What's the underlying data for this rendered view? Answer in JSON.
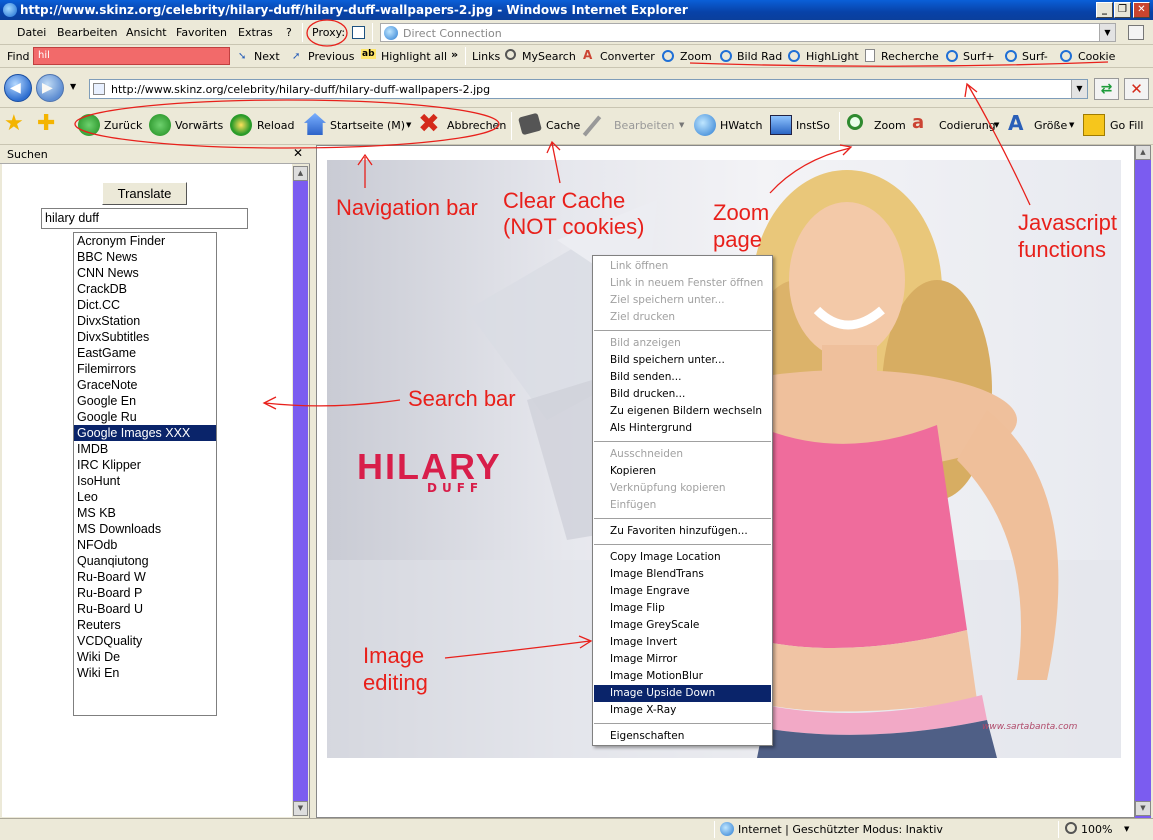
{
  "window": {
    "title": "http://www.skinz.org/celebrity/hilary-duff/hilary-duff-wallpapers-2.jpg - Windows Internet Explorer",
    "min_label": "_",
    "restore_label": "❐",
    "close_label": "✕"
  },
  "menubar": {
    "items": [
      "Datei",
      "Bearbeiten",
      "Ansicht",
      "Favoriten",
      "Extras",
      "?"
    ],
    "proxy_label": "Proxy:",
    "connection_value": "Direct Connection"
  },
  "findbar": {
    "find_label": "Find",
    "find_value": "hil",
    "next_label": "Next",
    "previous_label": "Previous",
    "highlight_label": "Highlight all",
    "links_label": "Links",
    "links": [
      "MySearch",
      "Converter",
      "Zoom",
      "Bild Rad",
      "HighLight",
      "Recherche",
      "Surf+",
      "Surf-",
      "Cookie"
    ]
  },
  "address": {
    "url": "http://www.skinz.org/celebrity/hilary-duff/hilary-duff-wallpapers-2.jpg"
  },
  "toolbar": {
    "back": "Zurück",
    "forward": "Vorwärts",
    "reload": "Reload",
    "home": "Startseite (M)",
    "stop": "Abbrechen",
    "cache": "Cache",
    "edit": "Bearbeiten",
    "hwatch": "HWatch",
    "instso": "InstSo",
    "zoom": "Zoom",
    "encoding": "Codierung",
    "size": "Größe",
    "gofill": "Go Fill"
  },
  "sidebar": {
    "title": "Suchen",
    "close_label": "✕",
    "translate_label": "Translate",
    "search_value": "hilary duff",
    "items": [
      "Acronym Finder",
      "BBC News",
      "CNN News",
      "CrackDB",
      "Dict.CC",
      "DivxStation",
      "DivxSubtitles",
      "EastGame",
      "Filemirrors",
      "GraceNote",
      "Google En",
      "Google Ru",
      "Google Images XXX",
      "IMDB",
      "IRC Klipper",
      "IsoHunt",
      "Leo",
      "MS KB",
      "MS Downloads",
      "NFOdb",
      "Quanqiutong",
      "Ru-Board W",
      "Ru-Board P",
      "Ru-Board U",
      "Reuters",
      "VCDQuality",
      "Wiki De",
      "Wiki En"
    ],
    "selected_item": "Google Images XXX"
  },
  "photo": {
    "logo_main": "HILARY",
    "logo_sub": "DUFF",
    "watermark": "www.sartabanta.com"
  },
  "context_menu": {
    "groups": [
      [
        {
          "label": "Link öffnen",
          "disabled": true
        },
        {
          "label": "Link in neuem Fenster öffnen",
          "disabled": true
        },
        {
          "label": "Ziel speichern unter...",
          "disabled": true
        },
        {
          "label": "Ziel drucken",
          "disabled": true
        }
      ],
      [
        {
          "label": "Bild anzeigen",
          "disabled": true
        },
        {
          "label": "Bild speichern unter...",
          "disabled": false
        },
        {
          "label": "Bild senden...",
          "disabled": false
        },
        {
          "label": "Bild drucken...",
          "disabled": false
        },
        {
          "label": "Zu eigenen Bildern wechseln",
          "disabled": false
        },
        {
          "label": "Als Hintergrund",
          "disabled": false
        }
      ],
      [
        {
          "label": "Ausschneiden",
          "disabled": true
        },
        {
          "label": "Kopieren",
          "disabled": false
        },
        {
          "label": "Verknüpfung kopieren",
          "disabled": true
        },
        {
          "label": "Einfügen",
          "disabled": true
        }
      ],
      [
        {
          "label": "Zu Favoriten hinzufügen...",
          "disabled": false
        }
      ],
      [
        {
          "label": "Copy Image Location",
          "disabled": false
        },
        {
          "label": "Image BlendTrans",
          "disabled": false
        },
        {
          "label": "Image Engrave",
          "disabled": false
        },
        {
          "label": "Image Flip",
          "disabled": false
        },
        {
          "label": "Image GreyScale",
          "disabled": false
        },
        {
          "label": "Image Invert",
          "disabled": false
        },
        {
          "label": "Image Mirror",
          "disabled": false
        },
        {
          "label": "Image MotionBlur",
          "disabled": false
        },
        {
          "label": "Image Upside Down",
          "disabled": false,
          "highlighted": true
        },
        {
          "label": "Image X-Ray",
          "disabled": false
        }
      ],
      [
        {
          "label": "Eigenschaften",
          "disabled": false
        }
      ]
    ]
  },
  "annotations": {
    "navigation": "Navigation bar",
    "cache_line1": "Clear Cache",
    "cache_line2": "(NOT cookies)",
    "zoom_line1": "Zoom",
    "zoom_line2": "page",
    "js_line1": "Javascript",
    "js_line2": "functions",
    "search": "Search bar",
    "image_line1": "Image",
    "image_line2": "editing"
  },
  "statusbar": {
    "zone": "Internet | Geschützter Modus: Inaktiv",
    "zoom": "100%"
  },
  "colors": {
    "annotation": "#e8201b",
    "selection": "#0a246a",
    "scrollbar": "#7b5cf0",
    "find_field": "#f26a6a"
  }
}
